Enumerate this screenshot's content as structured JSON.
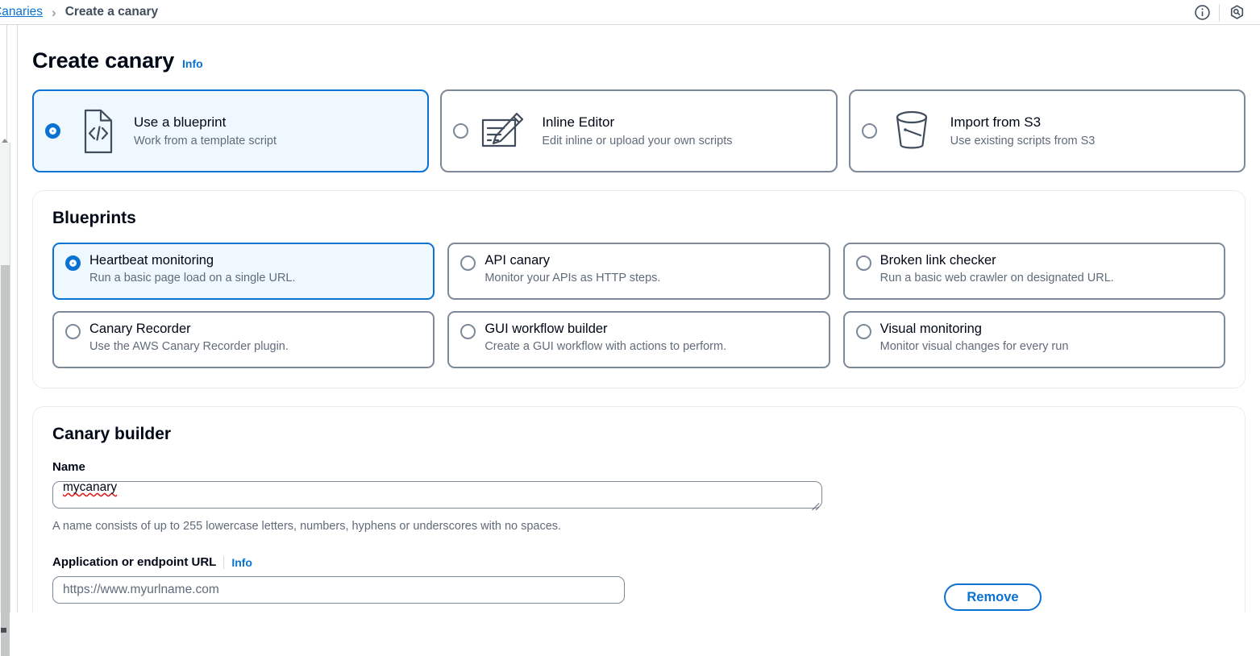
{
  "breadcrumb": {
    "parent": "Canaries",
    "separator": "›",
    "current": "Create a canary"
  },
  "topbar_icons": {
    "info": "info-circle-icon",
    "tools": "tools-hexagon-icon"
  },
  "header": {
    "title": "Create canary",
    "info_label": "Info"
  },
  "source_tiles": [
    {
      "title": "Use a blueprint",
      "subtitle": "Work from a template script",
      "icon": "code-document-icon",
      "selected": true
    },
    {
      "title": "Inline Editor",
      "subtitle": "Edit inline or upload your own scripts",
      "icon": "pencil-edit-document-icon",
      "selected": false
    },
    {
      "title": "Import from S3",
      "subtitle": "Use existing scripts from S3",
      "icon": "s3-bucket-icon",
      "selected": false
    }
  ],
  "blueprints": {
    "title": "Blueprints",
    "options": [
      {
        "title": "Heartbeat monitoring",
        "subtitle": "Run a basic page load on a single URL.",
        "selected": true
      },
      {
        "title": "API canary",
        "subtitle": "Monitor your APIs as HTTP steps.",
        "selected": false
      },
      {
        "title": "Broken link checker",
        "subtitle": "Run a basic web crawler on designated URL.",
        "selected": false
      },
      {
        "title": "Canary Recorder",
        "subtitle": "Use the AWS Canary Recorder plugin.",
        "selected": false
      },
      {
        "title": "GUI workflow builder",
        "subtitle": "Create a GUI workflow with actions to perform.",
        "selected": false
      },
      {
        "title": "Visual monitoring",
        "subtitle": "Monitor visual changes for every run",
        "selected": false
      }
    ]
  },
  "canary_builder": {
    "title": "Canary builder",
    "name_label": "Name",
    "name_value": "mycanary",
    "name_hint": "A name consists of up to 255 lowercase letters, numbers, hyphens or underscores with no spaces.",
    "url_label": "Application or endpoint URL",
    "url_info_label": "Info",
    "url_placeholder": "https://www.myurlname.com",
    "url_value": "",
    "remove_label": "Remove"
  },
  "colors": {
    "accent_blue": "#0972d3",
    "selected_tile_bg": "#f0f8ff",
    "border_gray": "#7d8998",
    "container_border": "#e9ebed",
    "text_secondary": "#5f6b7a",
    "spellcheck_red": "#e01a1a"
  }
}
